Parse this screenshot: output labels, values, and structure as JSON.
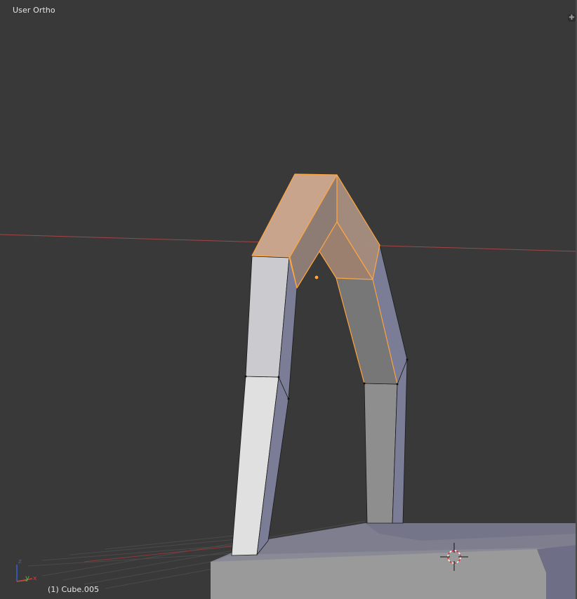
{
  "viewport": {
    "view_label": "User Ortho",
    "object_label": "(1) Cube.005",
    "corner_widget_glyph": "✚",
    "axes_gizmo": {
      "x": "x",
      "y": "y",
      "z": "z"
    }
  },
  "colors": {
    "background": "#393939",
    "selection": "#ffa640",
    "selected_face": "#c9a48c",
    "x_axis": "#b24646"
  },
  "icons": [
    "axes-gizmo-icon",
    "3d-cursor-icon",
    "object-origin-icon",
    "corner-split-icon"
  ]
}
